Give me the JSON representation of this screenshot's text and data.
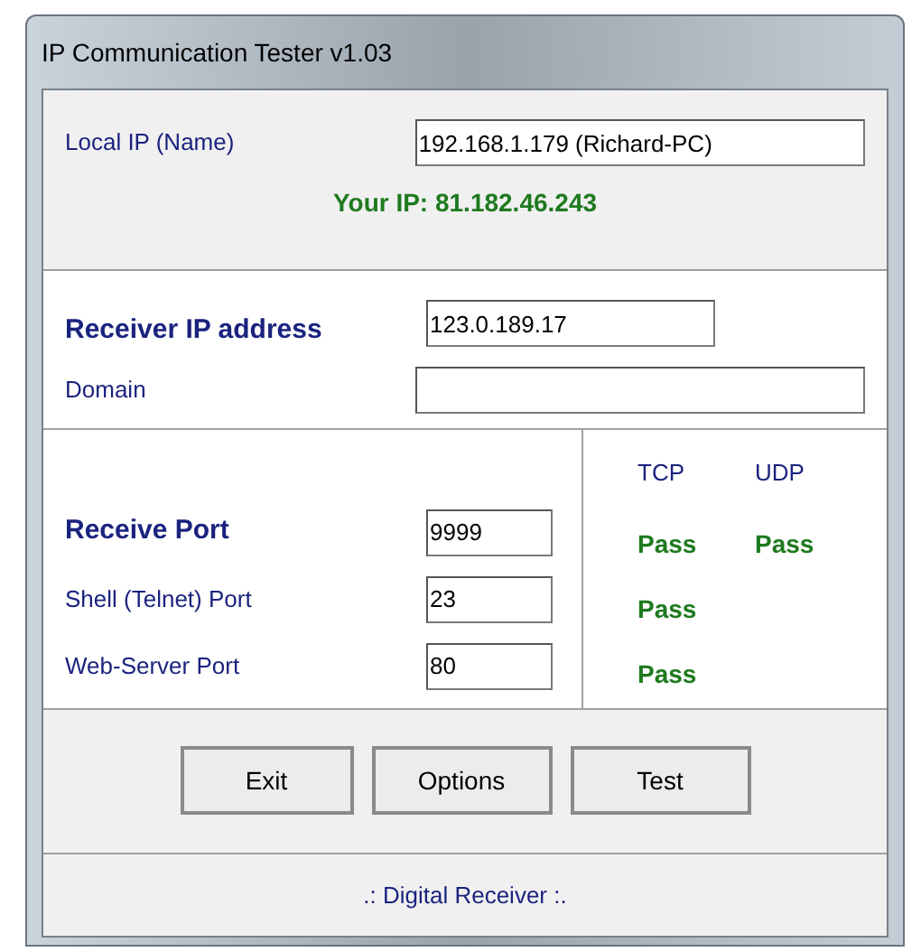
{
  "window": {
    "title": "IP Communication Tester v1.03"
  },
  "local": {
    "label": "Local IP (Name)",
    "value": "192.168.1.179 (Richard-PC)",
    "your_ip": "Your IP: 81.182.46.243"
  },
  "receiver": [
    {
      "label": "Receiver IP address",
      "value": "123.0.189.17",
      "bold": true
    },
    {
      "label": "Domain",
      "bold": false
    }
  ],
  "result_columns": [
    "TCP",
    "UDP"
  ],
  "ports": [
    {
      "label": "Receive Port",
      "value": "9999",
      "bold": true,
      "results": [
        "Pass",
        "Pass"
      ]
    },
    {
      "label": "Shell (Telnet) Port",
      "value": "23",
      "bold": false,
      "results": [
        "Pass"
      ]
    },
    {
      "label": "Web-Server Port",
      "value": "80",
      "bold": false,
      "results": [
        "Pass"
      ]
    }
  ],
  "buttons": [
    "Exit",
    "Options",
    "Test"
  ],
  "footer": ".: Digital Receiver :."
}
